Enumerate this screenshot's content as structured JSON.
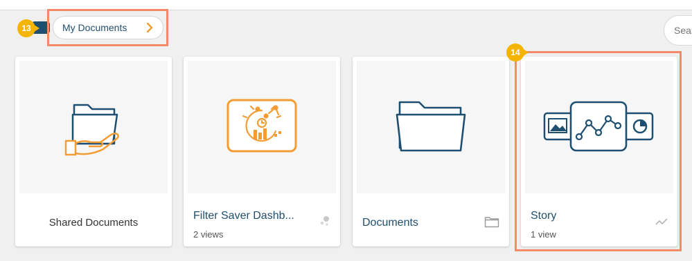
{
  "breadcrumb": {
    "label": "My Documents"
  },
  "search": {
    "placeholder": "Sear"
  },
  "callouts": {
    "breadcrumb": "13",
    "story_card": "14"
  },
  "cards": [
    {
      "title": "Shared Documents",
      "subtitle": "",
      "icon": "shared-folder-hand-icon"
    },
    {
      "title": "Filter Saver Dashb...",
      "subtitle": "2 views",
      "icon": "dashboard-icon"
    },
    {
      "title": "Documents",
      "subtitle": "",
      "icon": "folder-icon"
    },
    {
      "title": "Story",
      "subtitle": "1 view",
      "icon": "story-icon"
    }
  ],
  "colors": {
    "accent": "#f28b66",
    "badge": "#f5b400",
    "brand": "#1f4e6e",
    "dashboard": "#f39c34"
  }
}
